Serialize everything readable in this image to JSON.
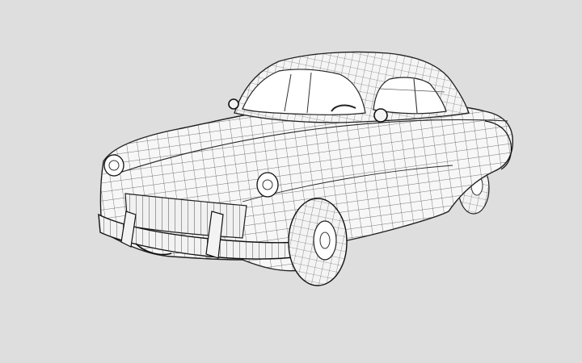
{
  "scene": {
    "subject": "wireframe-mesh-car",
    "render_style": "wireframe-over-white-shaded",
    "colors": {
      "background": "#dedede",
      "surface": "#f7f7f7",
      "mesh_line": "#4a4a4a",
      "outline": "#1e1e1e",
      "glass": "#ffffff"
    },
    "visible_text": []
  }
}
